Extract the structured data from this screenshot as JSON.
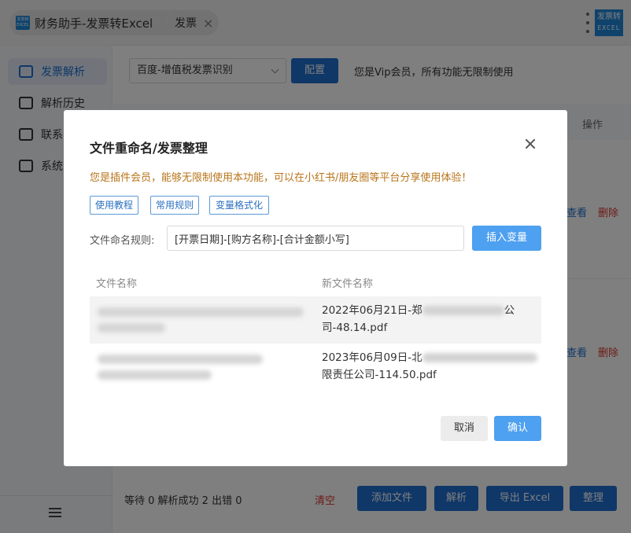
{
  "window": {
    "title": "财务助手-发票转Excel",
    "tab2": "发票",
    "tab_close": "×",
    "logo_top": "发票转",
    "logo_bottom": "EXCEL"
  },
  "sidebar": {
    "items": [
      {
        "label": "发票解析",
        "icon": "ticket-icon",
        "active": true
      },
      {
        "label": "解析历史",
        "icon": "history-icon"
      },
      {
        "label": "联系",
        "icon": "chat-icon"
      },
      {
        "label": "系统",
        "icon": "settings-icon"
      }
    ],
    "menu_icon": "hamburger-icon"
  },
  "main": {
    "engine_select": "百度-增值税发票识别",
    "config_button": "配置",
    "vip_text": "您是Vip会员，所有功能无限制使用",
    "table_header_operation": "操作",
    "rows": [
      {
        "view": "查看",
        "delete": "删除"
      },
      {
        "view": "查看",
        "delete": "删除"
      }
    ],
    "status": "等待 0  解析成功 2  出错 0",
    "clear_button": "清空",
    "add_file_button": "添加文件",
    "parse_button": "解析",
    "export_button": "导出 Excel",
    "organize_button": "整理"
  },
  "dialog": {
    "title": "文件重命名/发票整理",
    "notice": "您是插件会员，能够无限制使用本功能，可以在小红书/朋友圈等平台分享使用体验！",
    "tags": [
      "使用教程",
      "常用规则",
      "变量格式化"
    ],
    "rule_label": "文件命名规则:",
    "rule_value": "[开票日期]-[购方名称]-[合计金额小写]",
    "insert_button": "插入变量",
    "col_old": "文件名称",
    "col_new": "新文件名称",
    "files": [
      {
        "new_line1_prefix": "2022年06月21日-郑",
        "new_line1_suffix": "公",
        "new_line2": "司-48.14.pdf"
      },
      {
        "new_line1_prefix": "2023年06月09日-北",
        "new_line1_suffix": "",
        "new_line2": "限责任公司-114.50.pdf"
      }
    ],
    "cancel_button": "取消",
    "ok_button": "确认"
  },
  "colors": {
    "primary": "#1f6fd1",
    "primary_light": "#4ea0f0",
    "notice": "#b8741a",
    "danger": "#d9342b"
  }
}
